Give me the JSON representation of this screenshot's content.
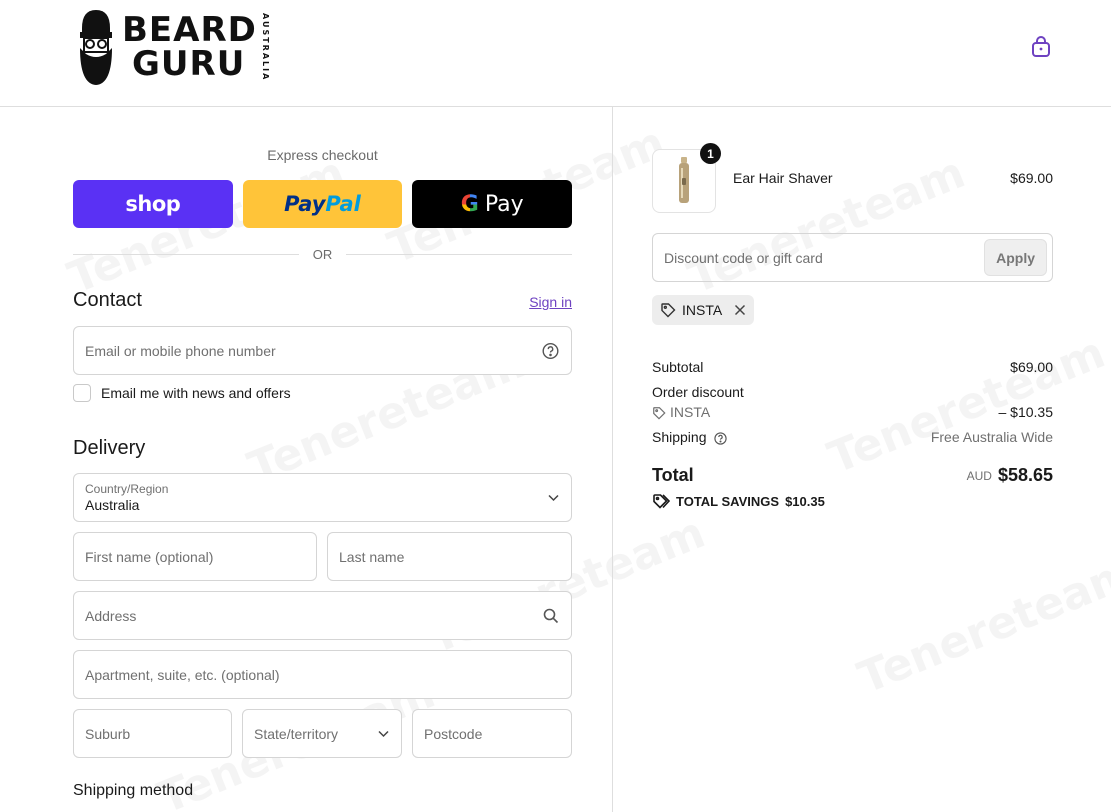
{
  "header": {
    "brand_top": "BEARD",
    "brand_bottom": "GURU",
    "brand_country": "AUSTRALIA"
  },
  "express": {
    "title": "Express checkout",
    "shop_label": "shop",
    "paypal_label_1": "Pay",
    "paypal_label_2": "Pal",
    "gpay_g": "G",
    "gpay_label": "Pay",
    "or_text": "OR"
  },
  "contact": {
    "title": "Contact",
    "sign_in": "Sign in",
    "email_placeholder": "Email or mobile phone number",
    "newsletter_label": "Email me with news and offers"
  },
  "delivery": {
    "title": "Delivery",
    "country_label": "Country/Region",
    "country_value": "Australia",
    "first_name_placeholder": "First name (optional)",
    "last_name_placeholder": "Last name",
    "address_placeholder": "Address",
    "apartment_placeholder": "Apartment, suite, etc. (optional)",
    "suburb_placeholder": "Suburb",
    "state_placeholder": "State/territory",
    "postcode_placeholder": "Postcode"
  },
  "shipping_method": {
    "title": "Shipping method"
  },
  "order": {
    "product_name": "Ear Hair Shaver",
    "product_price": "$69.00",
    "quantity": "1",
    "discount_placeholder": "Discount code or gift card",
    "apply_label": "Apply",
    "applied_code": "INSTA",
    "subtotal_label": "Subtotal",
    "subtotal_value": "$69.00",
    "order_discount_label": "Order discount",
    "discount_code": "INSTA",
    "discount_value": "– $10.35",
    "shipping_label": "Shipping",
    "shipping_value": "Free Australia Wide",
    "total_label": "Total",
    "currency": "AUD",
    "total_value": "$58.65",
    "savings_label": "TOTAL SAVINGS",
    "savings_value": "$10.35"
  },
  "watermark": "Tenereteam",
  "colors": {
    "shop": "#5a31f4",
    "paypal": "#ffc439",
    "gpay": "#000000",
    "link": "#6e42c1"
  }
}
